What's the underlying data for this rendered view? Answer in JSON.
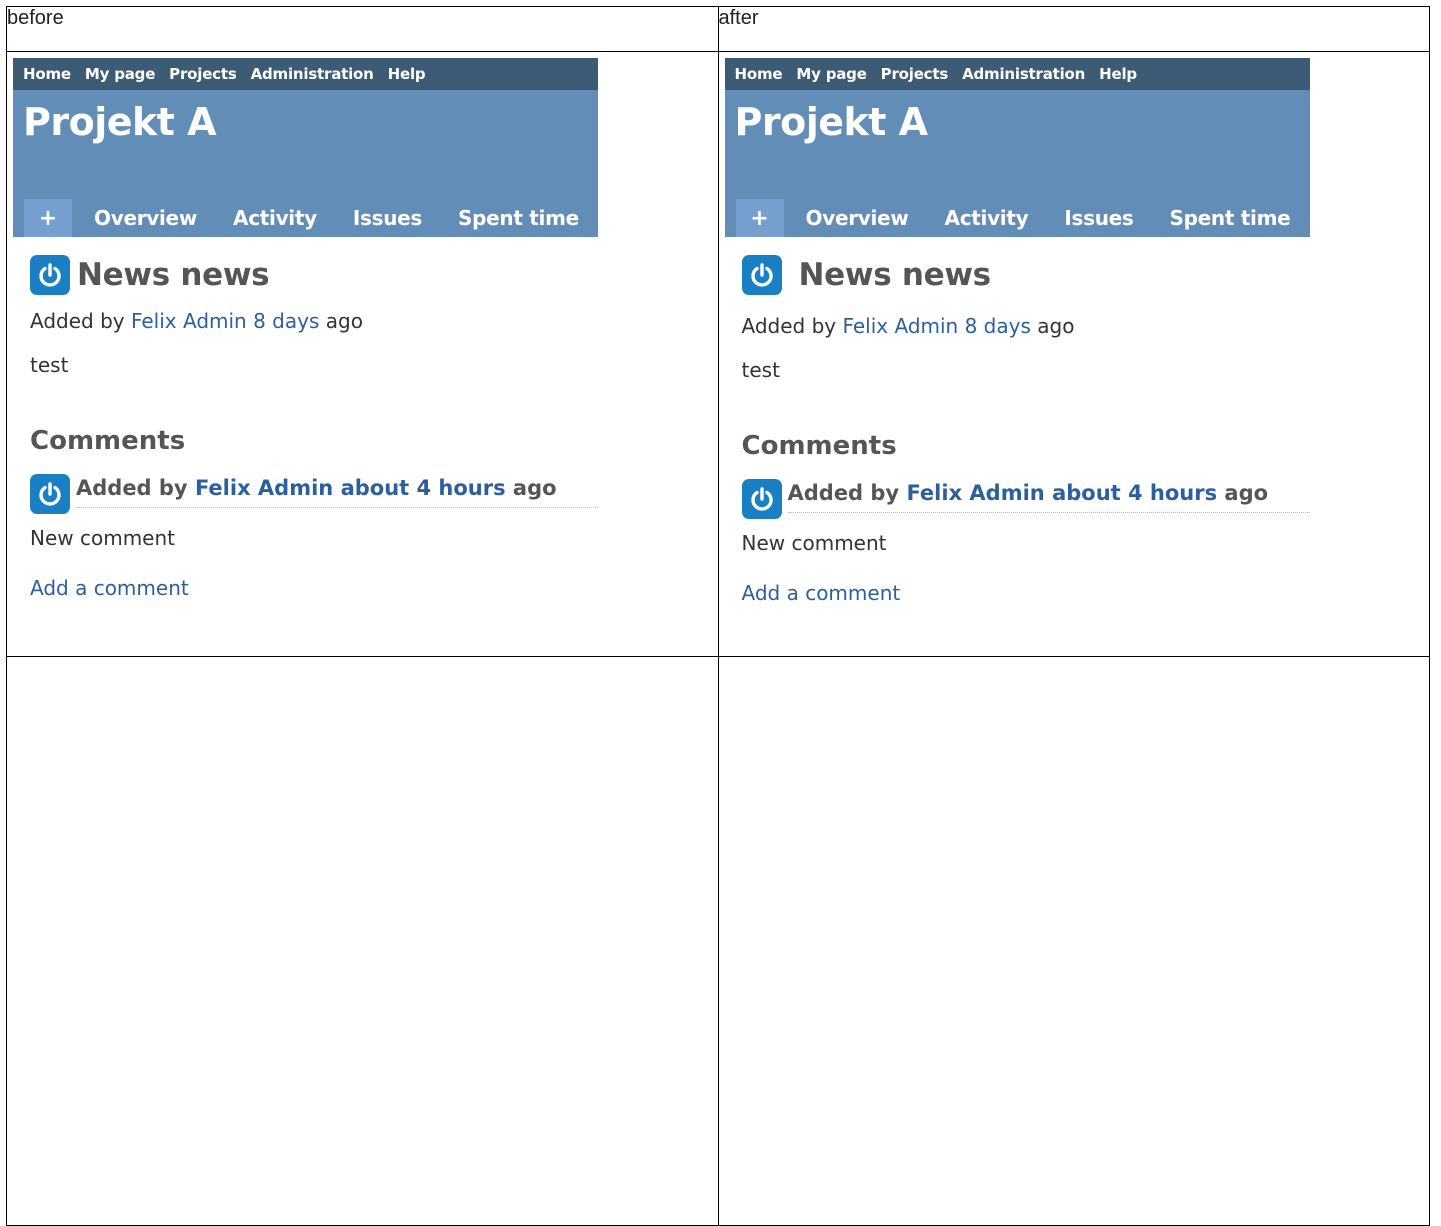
{
  "labels": {
    "before": "before",
    "after": "after"
  },
  "top_menu": [
    "Home",
    "My page",
    "Projects",
    "Administration",
    "Help"
  ],
  "project_title": "Projekt A",
  "main_menu": {
    "plus": "+",
    "tabs": [
      "Overview",
      "Activity",
      "Issues",
      "Spent time"
    ]
  },
  "news": {
    "title": "News news",
    "added_by_prefix": "Added by",
    "author": "Felix Admin",
    "age": "8 days",
    "ago": "ago",
    "body": "test"
  },
  "comments": {
    "heading": "Comments",
    "items": [
      {
        "added_by_prefix": "Added by",
        "author": "Felix Admin",
        "age": "about 4 hours",
        "ago": "ago",
        "text": "New comment"
      }
    ],
    "add_link": "Add a comment"
  },
  "colors": {
    "top_menu_bg": "#3e5b76",
    "header_bg": "#628db6",
    "plus_tab_bg": "#759fcf",
    "link": "#2d5f9e",
    "avatar_bg": "#1b7fc4"
  }
}
